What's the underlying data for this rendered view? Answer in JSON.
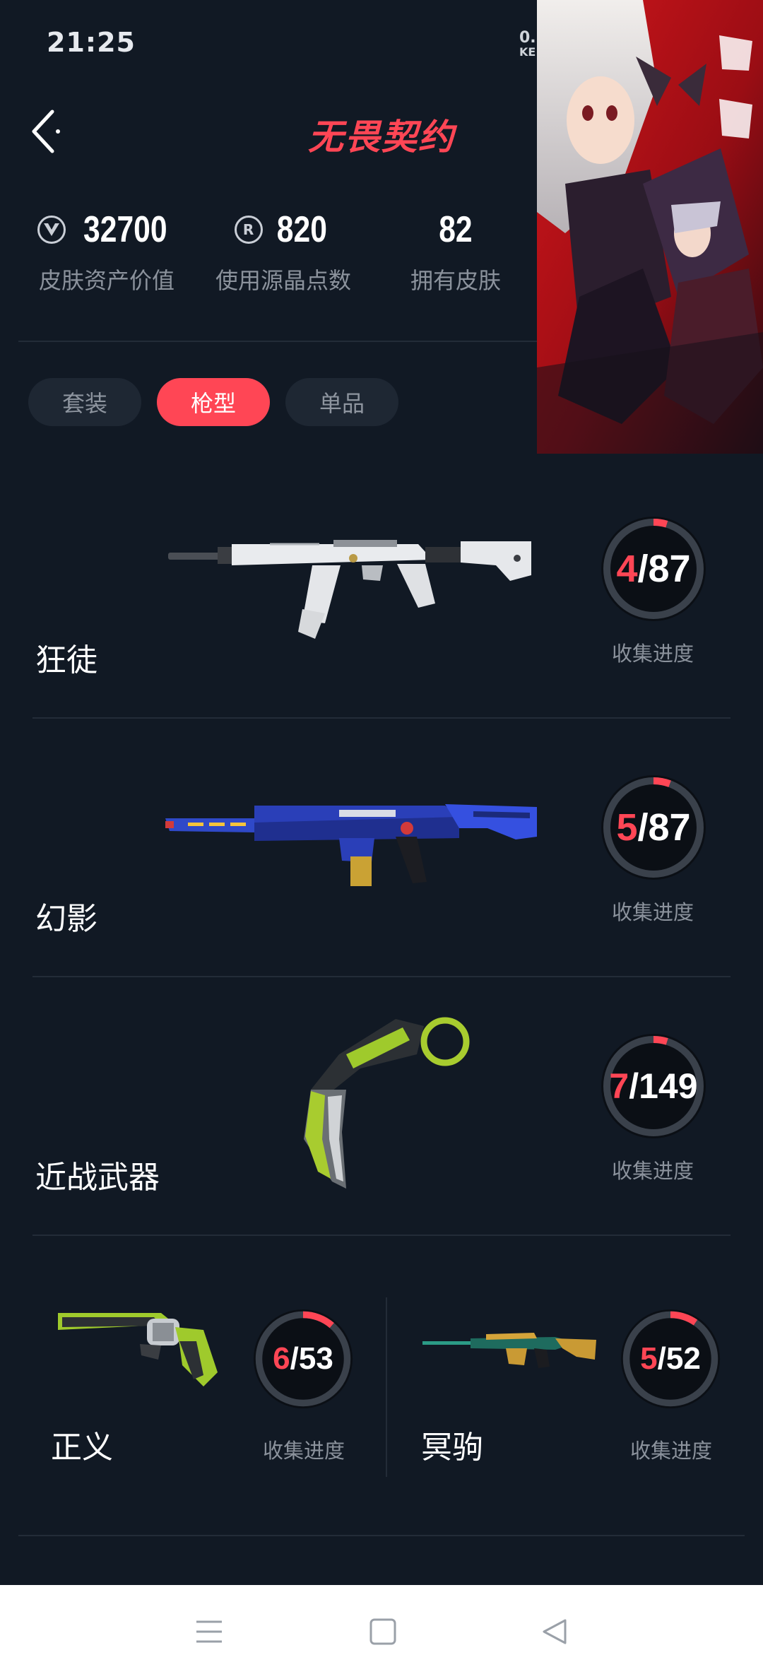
{
  "status_bar": {
    "time": "21:25",
    "network_speed": "0.",
    "network_unit": "KE"
  },
  "header": {
    "logo_text": "无畏契约"
  },
  "stats": [
    {
      "icon": "valorant-points-icon",
      "value": "32700",
      "label": "皮肤资产价值"
    },
    {
      "icon": "radianite-icon",
      "value": "820",
      "label": "使用源晶点数"
    },
    {
      "icon": "",
      "value": "82",
      "label": "拥有皮肤"
    }
  ],
  "tabs": [
    {
      "label": "套装",
      "active": false
    },
    {
      "label": "枪型",
      "active": true
    },
    {
      "label": "单品",
      "active": false
    }
  ],
  "weapons": [
    {
      "name": "狂徒",
      "owned": "4",
      "total": "/87",
      "fraction": 0.046,
      "caption": "收集进度",
      "image": "vandal-skin-image"
    },
    {
      "name": "幻影",
      "owned": "5",
      "total": "/87",
      "fraction": 0.057,
      "caption": "收集进度",
      "image": "phantom-skin-image"
    },
    {
      "name": "近战武器",
      "owned": "7",
      "total": "/149",
      "fraction": 0.047,
      "caption": "收集进度",
      "image": "melee-skin-image"
    },
    {
      "name": "正义",
      "owned": "6",
      "total": "/53",
      "fraction": 0.113,
      "caption": "收集进度",
      "image": "sheriff-skin-image"
    },
    {
      "name": "冥驹",
      "owned": "5",
      "total": "/52",
      "fraction": 0.096,
      "caption": "收集进度",
      "image": "operator-skin-image"
    }
  ],
  "colors": {
    "background": "#111924",
    "accent": "#ff4655",
    "muted_text": "#8b929c",
    "ring_track": "#3a414b"
  },
  "nav_bar": {
    "icons": [
      "menu-icon",
      "home-icon",
      "back-icon"
    ]
  }
}
